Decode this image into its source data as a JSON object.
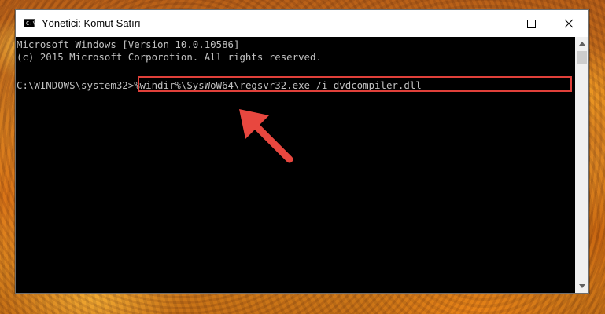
{
  "window": {
    "title": "Yönetici: Komut Satırı",
    "app_icon_text": "C:\\"
  },
  "console": {
    "line1": "Microsoft Windows [Version 10.0.10586]",
    "line2": "(c) 2015 Microsoft Corporotion. All rights reserved.",
    "prompt": "C:\\WINDOWS\\system32>",
    "command": "%windir%\\SysWoW64\\regsvr32.exe /i dvdcompiler.dll"
  },
  "icons": {
    "minimize": "minimize-icon",
    "maximize": "maximize-icon",
    "close": "close-icon",
    "annotation": "red-arrow-icon"
  },
  "colors": {
    "highlight": "#e0403a",
    "arrow": "#e8473f",
    "console_text": "#c0c0c0",
    "console_bg": "#000000"
  }
}
